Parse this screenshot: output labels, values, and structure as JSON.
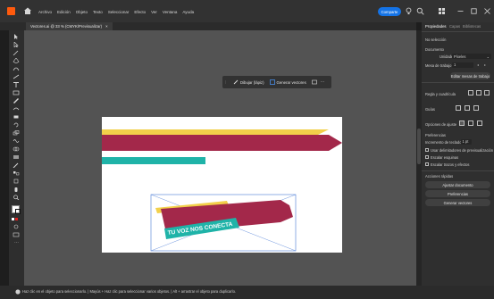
{
  "menu": [
    "Archivo",
    "Edición",
    "Objeto",
    "Texto",
    "Seleccionar",
    "Efecto",
    "Ver",
    "Ventana",
    "Ayuda"
  ],
  "share_label": "Comparte",
  "document_tab": {
    "title": "Vectores.ai @ 33 % (CMYK/Previsualizar)",
    "close": "×"
  },
  "context_bar": {
    "draw_label": "Dibujar (lápiz)",
    "generate_label": "Generar vectores",
    "more": "⋯"
  },
  "panel": {
    "tabs": [
      "Propiedades",
      "Capas",
      "Bibliotecas"
    ],
    "no_selection": "No selección",
    "document_label": "Documento",
    "units_label": "Unidades",
    "units_value": "Píxeles",
    "artboard_label": "Mesa de trabajo",
    "artboard_value": "1",
    "edit_artboards": "Editar mesas de trabajo",
    "rulers_label": "Regla y cuadrícula",
    "guides_label": "Guías",
    "snap_label": "Opciones de ajuste",
    "preferences_label": "Preferencias",
    "keyboard_increment_label": "Incremento de teclado:",
    "keyboard_increment_value": "1 pt",
    "checkbox_preview": "Usar delimitadores de previsualización",
    "checkbox_corners": "Escalar esquinas",
    "checkbox_strokes": "Escalar trazos y efectos",
    "quick_actions_label": "Acciones rápidas",
    "btn_document_setup": "Ajustar documento",
    "btn_preferences": "Preferencias",
    "btn_generate": "Generar vectores"
  },
  "artwork": {
    "banner_text": "TU VOZ NOS CONECTA"
  },
  "status": {
    "text": "Haz clic en el objeto para seleccionarlo.  |  Mayús + Haz clic para seleccionar varios objetos.  |  Alt + arrastrar el objeto para duplicarlo."
  },
  "colors": {
    "accent": "#1473e6",
    "maroon": "#a3284a",
    "yellow": "#f2d04a",
    "teal": "#1fb3a8"
  }
}
